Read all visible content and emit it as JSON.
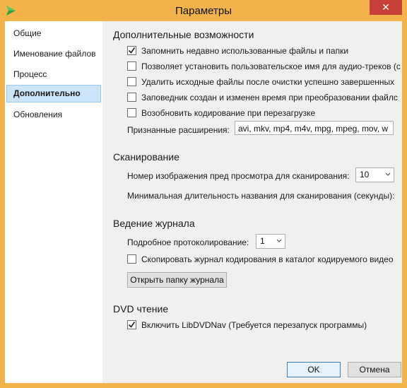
{
  "window": {
    "title": "Параметры",
    "close_label": "✕",
    "accent": "#f3b24a",
    "close_color": "#c7403a"
  },
  "sidebar": {
    "items": [
      {
        "label": "Общие"
      },
      {
        "label": "Именование файлов"
      },
      {
        "label": "Процесс"
      },
      {
        "label": "Дополнительно",
        "selected": true
      },
      {
        "label": "Обновления"
      }
    ]
  },
  "advanced": {
    "title": "Дополнительные возможности",
    "options": [
      {
        "label": "Запомнить недавно использованные файлы и папки",
        "checked": true
      },
      {
        "label": "Позволяет установить пользовательское имя для аудио-треков (с",
        "checked": false
      },
      {
        "label": "Удалить исходные файлы после очистки успешно завершенных",
        "checked": false
      },
      {
        "label": "Заповедник создан и изменен время при преобразовании файлс",
        "checked": false
      },
      {
        "label": "Возобновить кодирование при перезагрузке",
        "checked": false
      }
    ],
    "extensions_label": "Признанные расширения:",
    "extensions_value": "avi, mkv, mp4, m4v, mpg, mpeg, mov, w"
  },
  "scanning": {
    "title": "Сканирование",
    "preview_label": "Номер изображения пред просмотра для сканирования:",
    "preview_value": "10",
    "min_duration_label": "Минимальная длительность названия для сканирования (секунды):"
  },
  "logging": {
    "title": "Ведение журнала",
    "verbosity_label": "Подробное протоколирование:",
    "verbosity_value": "1",
    "copy_log_label": "Скопировать журнал кодирования в каталог кодируемого видео",
    "copy_log_checked": false,
    "open_folder_label": "Открыть папку журнала"
  },
  "dvd": {
    "title": "DVD чтение",
    "libdvdnav_label": "Включить LibDVDNav (Требуется перезапуск программы)",
    "libdvdnav_checked": true
  },
  "footer": {
    "ok_label": "OK",
    "cancel_label": "Отмена"
  }
}
